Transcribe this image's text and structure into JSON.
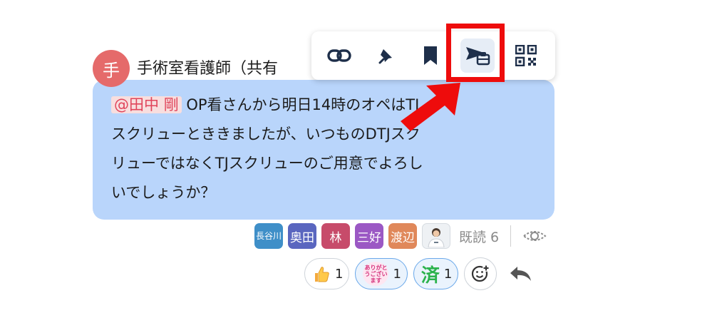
{
  "sender": {
    "avatar_char": "手",
    "name": "手術室看護師（共有"
  },
  "message": {
    "mention": "@田中 剛",
    "line1": " OP看さんから明日14時のオペはTJ",
    "line2": "スクリューとききましたが、いつものDTJスク",
    "line3": "リューではなくTJスクリューのご用意でよろし",
    "line4": "いでしょうか？"
  },
  "toolbar": {
    "items": [
      {
        "icon": "link-icon"
      },
      {
        "icon": "pin-icon"
      },
      {
        "icon": "bookmark-icon"
      },
      {
        "icon": "forward-to-box-icon",
        "active": true
      },
      {
        "icon": "qr-code-icon"
      }
    ]
  },
  "readers": [
    {
      "label": "長谷川",
      "color": "#3f8fc8"
    },
    {
      "label": "奥田",
      "color": "#5a66bf"
    },
    {
      "label": "林",
      "color": "#c74b6a"
    },
    {
      "label": "三好",
      "color": "#9b58c4"
    },
    {
      "label": "渡辺",
      "color": "#e0885a"
    },
    {
      "label": "",
      "color": "#eef1f4"
    }
  ],
  "read_status": {
    "label": "既読 6"
  },
  "reactions": [
    {
      "icon": "thumbs-up",
      "count": "1"
    },
    {
      "icon": "thank-you-stamp",
      "stamp_text": "ありがとうございます",
      "count": "1",
      "selected": true
    },
    {
      "icon": "done-stamp",
      "stamp_text": "済",
      "count": "1",
      "selected": true
    }
  ],
  "colors": {
    "bubble": "#b9d5fb",
    "mention_text": "#e0445a",
    "highlight": "#ee0c0c"
  }
}
